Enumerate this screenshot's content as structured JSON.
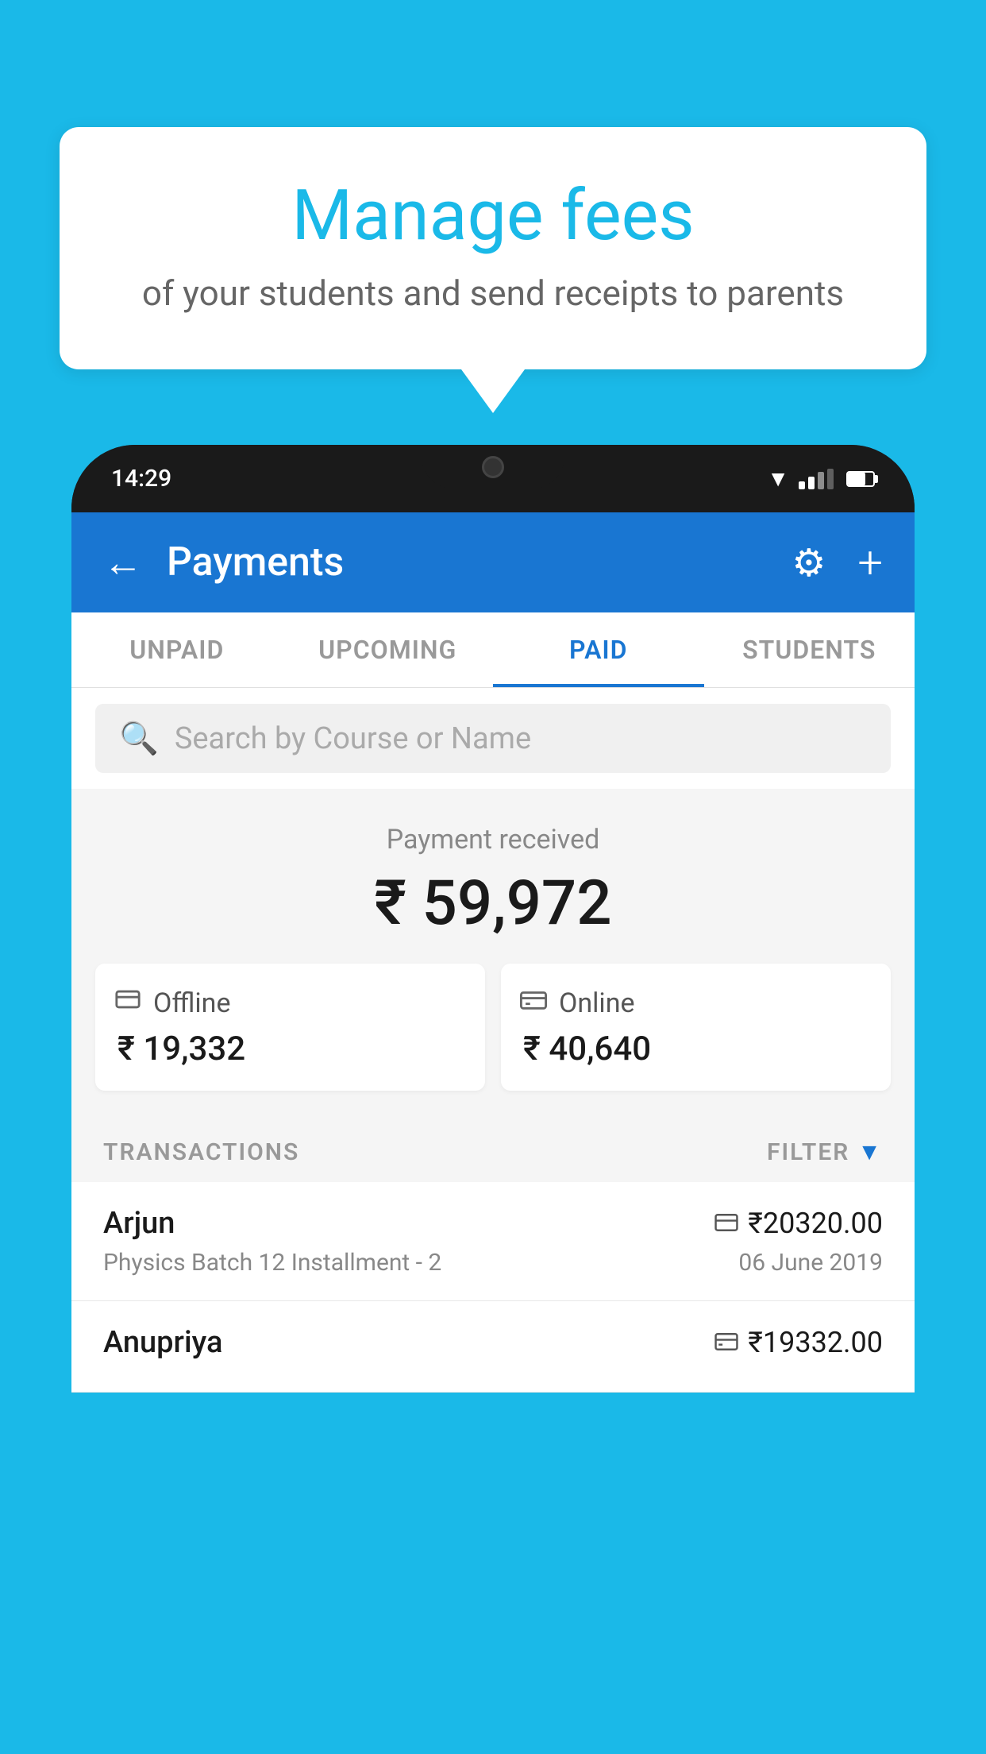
{
  "page": {
    "background_color": "#1ab9e8"
  },
  "speech_bubble": {
    "title": "Manage fees",
    "subtitle": "of your students and send receipts to parents"
  },
  "status_bar": {
    "time": "14:29"
  },
  "app_header": {
    "title": "Payments",
    "back_label": "←",
    "plus_label": "+"
  },
  "tabs": [
    {
      "id": "unpaid",
      "label": "UNPAID",
      "active": false
    },
    {
      "id": "upcoming",
      "label": "UPCOMING",
      "active": false
    },
    {
      "id": "paid",
      "label": "PAID",
      "active": true
    },
    {
      "id": "students",
      "label": "STUDENTS",
      "active": false
    }
  ],
  "search": {
    "placeholder": "Search by Course or Name"
  },
  "payment_summary": {
    "label": "Payment received",
    "total_amount": "₹ 59,972",
    "offline": {
      "label": "Offline",
      "amount": "₹ 19,332"
    },
    "online": {
      "label": "Online",
      "amount": "₹ 40,640"
    }
  },
  "transactions": {
    "header_label": "TRANSACTIONS",
    "filter_label": "FILTER",
    "items": [
      {
        "name": "Arjun",
        "course": "Physics Batch 12 Installment - 2",
        "amount": "₹20320.00",
        "date": "06 June 2019",
        "payment_type": "card"
      },
      {
        "name": "Anupriya",
        "course": "",
        "amount": "₹19332.00",
        "date": "",
        "payment_type": "offline"
      }
    ]
  }
}
